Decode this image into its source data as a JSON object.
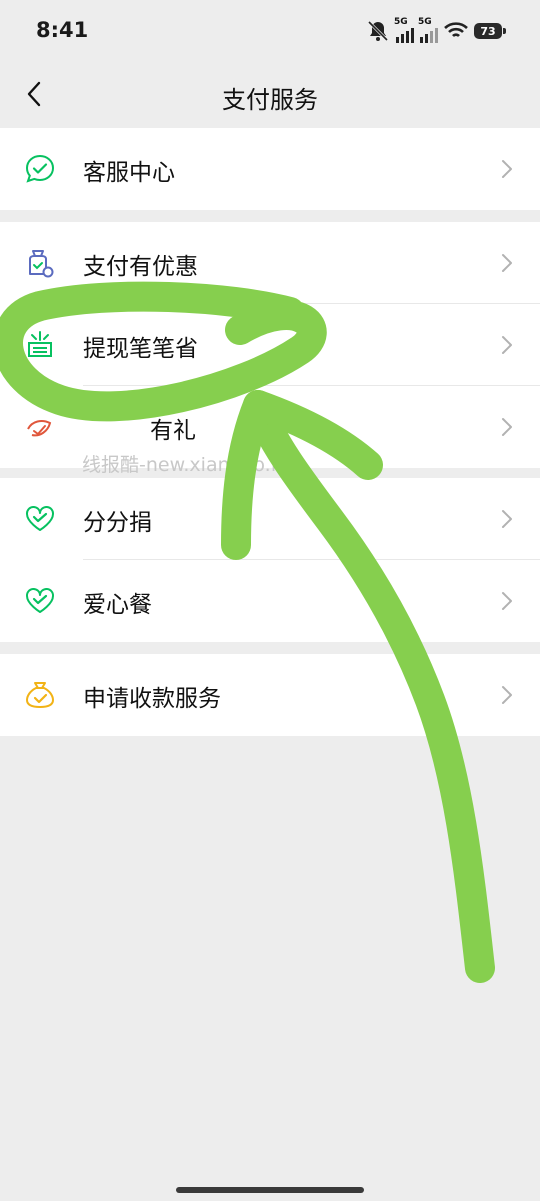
{
  "status": {
    "time": "8:41",
    "net1": "5G",
    "net2": "5G",
    "battery": "73"
  },
  "nav": {
    "title": "支付服务"
  },
  "groups": [
    {
      "items": [
        {
          "label": "客服中心",
          "icon": "chat-check-icon"
        }
      ]
    },
    {
      "items": [
        {
          "label": "支付有优惠",
          "icon": "coupon-bag-icon"
        },
        {
          "label": "提现笔笔省",
          "icon": "save-icon"
        },
        {
          "label": "有礼",
          "icon": "gift-icon"
        }
      ]
    },
    {
      "items": [
        {
          "label": "分分捐",
          "icon": "heart-check-icon"
        },
        {
          "label": "爱心餐",
          "icon": "heart-check-icon"
        }
      ]
    },
    {
      "items": [
        {
          "label": "申请收款服务",
          "icon": "money-bag-icon"
        }
      ]
    }
  ],
  "watermark": "线报酷-new.xianbao.fun",
  "colors": {
    "brand_green": "#07c160",
    "annotation_green": "#86cf4e",
    "coupon_blue": "#5b6bbf",
    "gift_red": "#e0573c",
    "money_yellow": "#f2b316"
  }
}
